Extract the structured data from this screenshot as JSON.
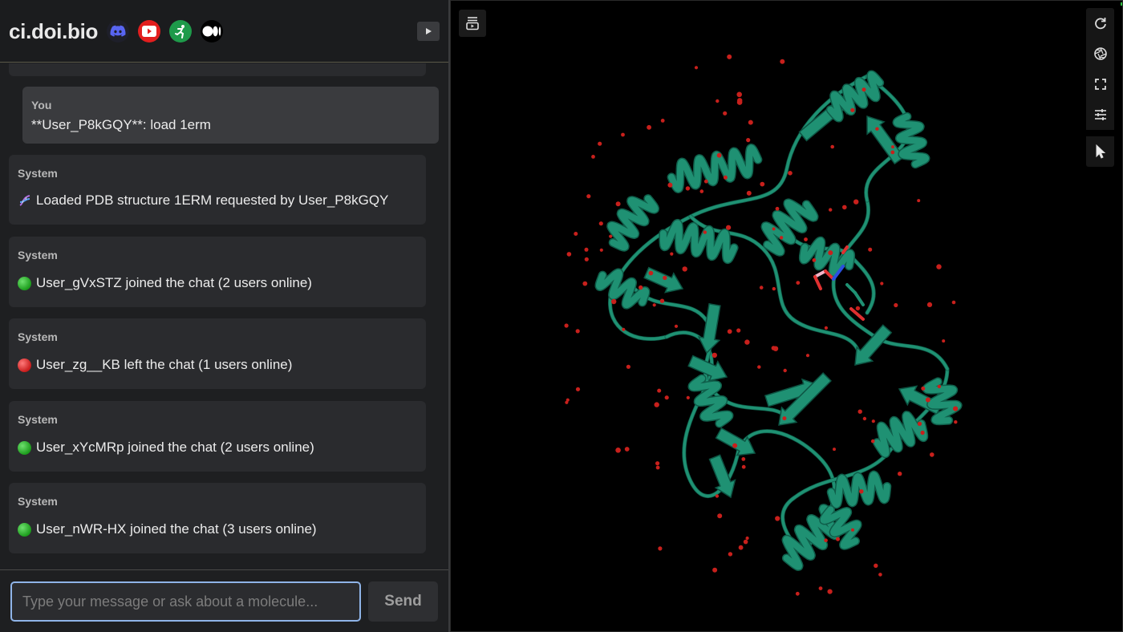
{
  "header": {
    "brand": "ci.doi.bio",
    "social_icons": [
      "discord-icon",
      "youtube-icon",
      "runner-icon",
      "medium-icon"
    ],
    "play_icon": "play-icon"
  },
  "messages": [
    {
      "sender": "You",
      "text": "**User_P8kGQY**: load 1erm",
      "kind": "user"
    },
    {
      "sender": "System",
      "text": "Loaded PDB structure 1ERM requested by User_P8kGQY",
      "icon": "dna-icon"
    },
    {
      "sender": "System",
      "text": "User_gVxSTZ joined the chat (2 users online)",
      "icon": "green-circle-icon"
    },
    {
      "sender": "System",
      "text": "User_zg__KB left the chat (1 users online)",
      "icon": "red-circle-icon"
    },
    {
      "sender": "System",
      "text": "User_xYcMRp joined the chat (2 users online)",
      "icon": "green-circle-icon"
    },
    {
      "sender": "System",
      "text": "User_nWR-HX joined the chat (3 users online)",
      "icon": "green-circle-icon"
    }
  ],
  "composer": {
    "placeholder": "Type your message or ask about a molecule...",
    "value": "",
    "send_label": "Send"
  },
  "viewer": {
    "structure": "1ERM",
    "ribbon_color": "#1f9173",
    "water_color": "#c8201c",
    "background": "#000000",
    "tools": [
      "rotate-icon",
      "aperture-icon",
      "fullscreen-icon",
      "sliders-icon",
      "cursor-icon"
    ],
    "panel_toggle_icon": "panel-toggle-icon"
  },
  "colors": {
    "panel_bg": "#1e1f21",
    "bubble_user": "#3a3b3e",
    "bubble_system": "#2a2b2e",
    "input_border": "#8fb4e8"
  }
}
